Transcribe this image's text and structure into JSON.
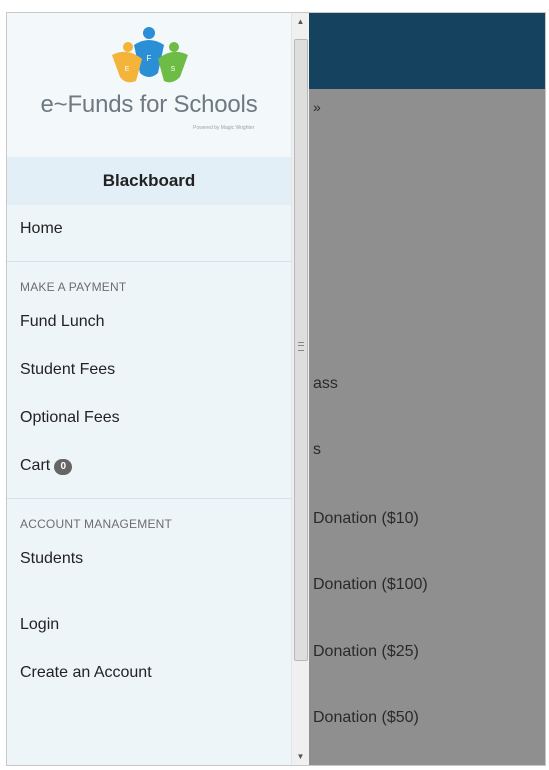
{
  "logo": {
    "title": "e~Funds for Schools",
    "subtitle": "Powered by Magic Wrighter"
  },
  "site": {
    "name": "Blackboard"
  },
  "menu": {
    "home": "Home",
    "make_payment": {
      "title": "MAKE A PAYMENT",
      "items": [
        "Fund Lunch",
        "Student Fees",
        "Optional Fees"
      ]
    },
    "cart": {
      "label": "Cart",
      "count": "0"
    },
    "account": {
      "title": "ACCOUNT MANAGEMENT",
      "items": [
        "Students"
      ]
    },
    "login": "Login",
    "create_account": "Create an Account"
  },
  "background": {
    "mark": "»",
    "lines": [
      "ass",
      "s",
      "Donation ($10)",
      "Donation ($100)",
      "Donation ($25)",
      "Donation ($50)"
    ]
  },
  "scrollbar": {
    "up_icon": "▲",
    "down_icon": "▼"
  },
  "colors": {
    "header": "#15425f",
    "drawer": "#eef5f9",
    "overlay": "#8f8f8f",
    "badge": "#666666"
  }
}
